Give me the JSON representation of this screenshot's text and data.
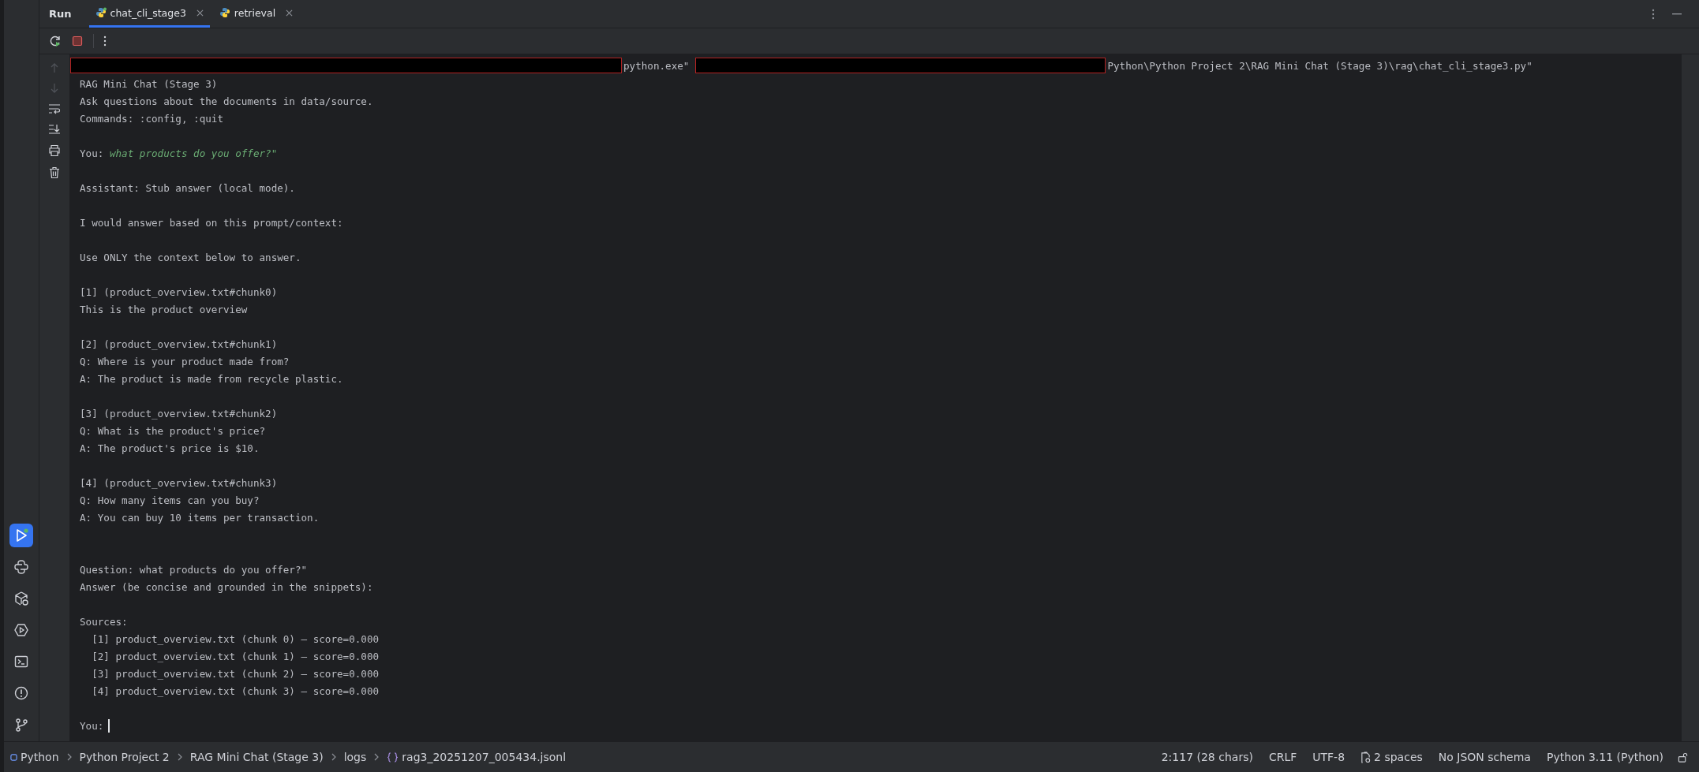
{
  "tool_window": {
    "title": "Run"
  },
  "tabs": [
    {
      "label": "chat_cli_stage3",
      "selected": true
    },
    {
      "label": "retrieval",
      "selected": false
    }
  ],
  "command_line": {
    "segments": [
      {
        "kind": "redacted"
      },
      {
        "kind": "text",
        "text": "python.exe\""
      },
      {
        "kind": "redacted"
      },
      {
        "kind": "text",
        "text": "Python\\Python Project 2\\RAG Mini Chat (Stage 3)\\rag\\chat_cli_stage3.py\""
      }
    ]
  },
  "console_lines": [
    {
      "kind": "text",
      "text": "RAG Mini Chat (Stage 3)"
    },
    {
      "kind": "text",
      "text": "Ask questions about the documents in data/source."
    },
    {
      "kind": "text",
      "text": "Commands: :config, :quit"
    },
    {
      "kind": "blank"
    },
    {
      "kind": "input",
      "prompt": "You:",
      "value": "what products do you offer?\""
    },
    {
      "kind": "blank"
    },
    {
      "kind": "text",
      "text": "Assistant: Stub answer (local mode)."
    },
    {
      "kind": "blank"
    },
    {
      "kind": "text",
      "text": "I would answer based on this prompt/context:"
    },
    {
      "kind": "blank"
    },
    {
      "kind": "text",
      "text": "Use ONLY the context below to answer."
    },
    {
      "kind": "blank"
    },
    {
      "kind": "text",
      "text": "[1] (product_overview.txt#chunk0)"
    },
    {
      "kind": "text",
      "text": "This is the product overview"
    },
    {
      "kind": "blank"
    },
    {
      "kind": "text",
      "text": "[2] (product_overview.txt#chunk1)"
    },
    {
      "kind": "text",
      "text": "Q: Where is your product made from?"
    },
    {
      "kind": "text",
      "text": "A: The product is made from recycle plastic."
    },
    {
      "kind": "blank"
    },
    {
      "kind": "text",
      "text": "[3] (product_overview.txt#chunk2)"
    },
    {
      "kind": "text",
      "text": "Q: What is the product's price?"
    },
    {
      "kind": "text",
      "text": "A: The product's price is $10."
    },
    {
      "kind": "blank"
    },
    {
      "kind": "text",
      "text": "[4] (product_overview.txt#chunk3)"
    },
    {
      "kind": "text",
      "text": "Q: How many items can you buy?"
    },
    {
      "kind": "text",
      "text": "A: You can buy 10 items per transaction."
    },
    {
      "kind": "blank"
    },
    {
      "kind": "blank"
    },
    {
      "kind": "text",
      "text": "Question: what products do you offer?\""
    },
    {
      "kind": "text",
      "text": "Answer (be concise and grounded in the snippets):"
    },
    {
      "kind": "blank"
    },
    {
      "kind": "text",
      "text": "Sources:"
    },
    {
      "kind": "text",
      "text": "  [1] product_overview.txt (chunk 0) — score=0.000"
    },
    {
      "kind": "text",
      "text": "  [2] product_overview.txt (chunk 1) — score=0.000"
    },
    {
      "kind": "text",
      "text": "  [3] product_overview.txt (chunk 2) — score=0.000"
    },
    {
      "kind": "text",
      "text": "  [4] product_overview.txt (chunk 3) — score=0.000"
    },
    {
      "kind": "blank"
    },
    {
      "kind": "prompt",
      "prompt": "You:"
    }
  ],
  "sidebar_tools": [
    {
      "kind": "run",
      "selected": true
    },
    {
      "kind": "python",
      "selected": false
    },
    {
      "kind": "packages",
      "selected": false
    },
    {
      "kind": "services",
      "selected": false
    },
    {
      "kind": "terminal",
      "selected": false
    },
    {
      "kind": "problems",
      "selected": false
    },
    {
      "kind": "git",
      "selected": false
    }
  ],
  "status_bar": {
    "breadcrumbs": [
      {
        "kind": "module",
        "label": "Python"
      },
      {
        "kind": "folder",
        "label": "Python Project 2"
      },
      {
        "kind": "folder",
        "label": "RAG Mini Chat (Stage 3)"
      },
      {
        "kind": "folder",
        "label": "logs"
      },
      {
        "kind": "json",
        "label": "rag3_20251207_005434.jsonl"
      }
    ],
    "items": [
      {
        "kind": "text",
        "label": "2:117 (28 chars)"
      },
      {
        "kind": "text",
        "label": "CRLF"
      },
      {
        "kind": "text",
        "label": "UTF-8"
      },
      {
        "kind": "indent",
        "label": "2 spaces"
      },
      {
        "kind": "text",
        "label": "No JSON schema"
      },
      {
        "kind": "text",
        "label": "Python 3.11 (Python)"
      }
    ]
  }
}
